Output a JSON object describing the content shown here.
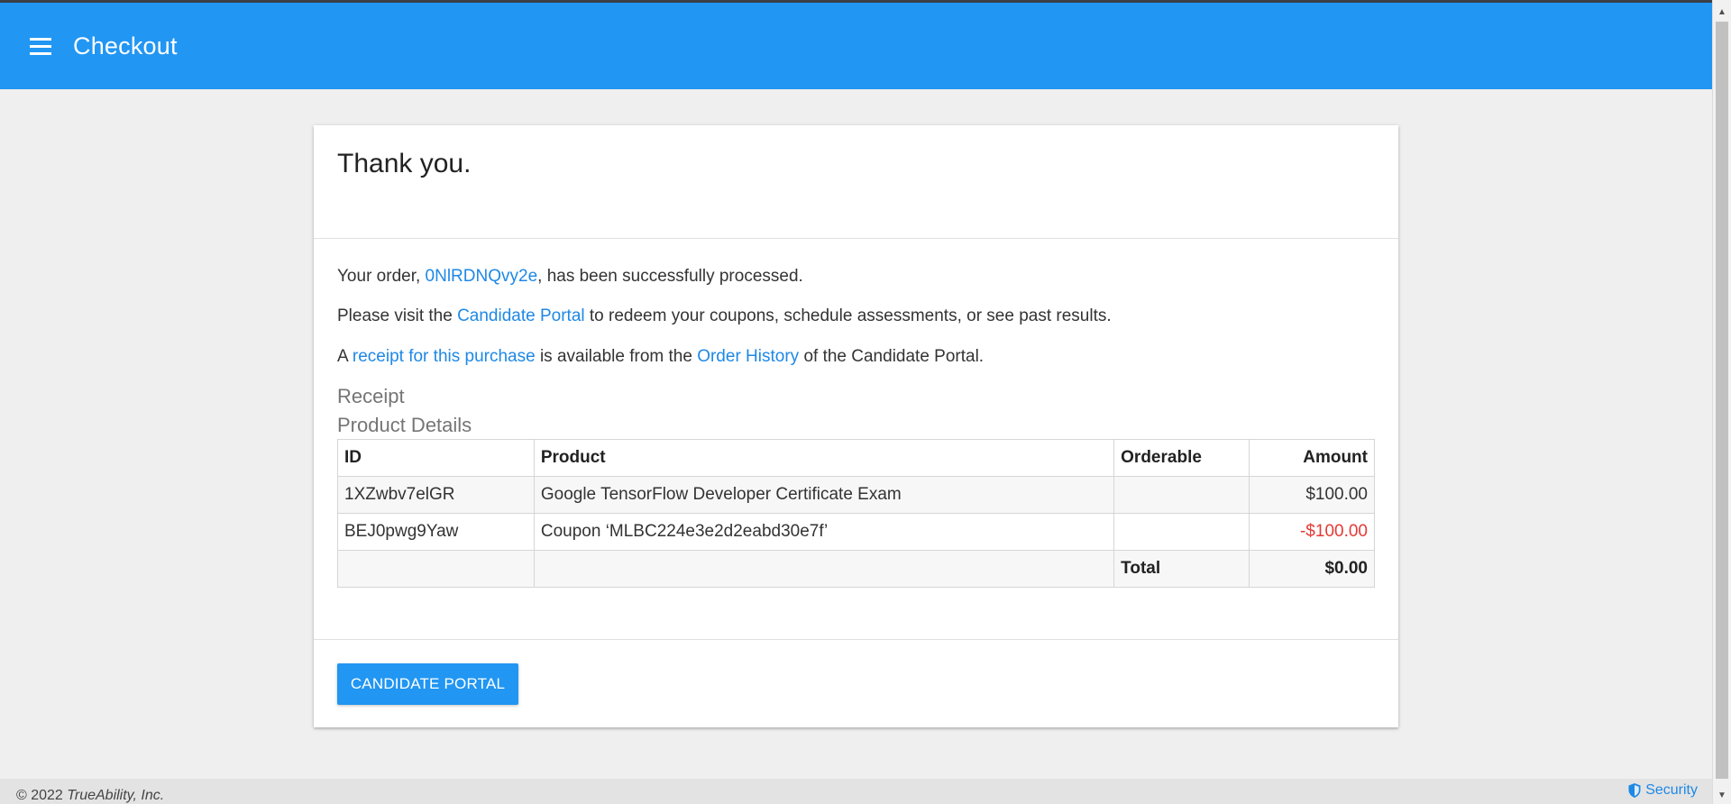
{
  "appbar": {
    "title": "Checkout",
    "menu_icon": "menu-icon"
  },
  "card": {
    "title": "Thank you.",
    "order_line": {
      "prefix": "Your order, ",
      "order_id": "0NlRDNQvy2e",
      "suffix": ", has been successfully processed."
    },
    "portal_line": {
      "prefix": "Please visit the ",
      "link": "Candidate Portal",
      "suffix": " to redeem your coupons, schedule assessments, or see past results."
    },
    "receipt_line": {
      "prefix": "A ",
      "link1": "receipt for this purchase",
      "middle": " is available from the ",
      "link2": "Order History",
      "suffix": " of the Candidate Portal."
    },
    "receipt_label": "Receipt",
    "product_details_label": "Product Details",
    "table": {
      "headers": [
        "ID",
        "Product",
        "Orderable",
        "Amount"
      ],
      "rows": [
        {
          "id": "1XZwbv7elGR",
          "product": "Google TensorFlow Developer Certificate Exam",
          "orderable": "",
          "amount": "$100.00"
        },
        {
          "id": "BEJ0pwg9Yaw",
          "product": "Coupon ‘MLBC224e3e2d2eabd30e7f’",
          "orderable": "",
          "amount": "-$100.00"
        }
      ],
      "total_label": "Total",
      "total_value": "$0.00"
    },
    "button_label": "CANDIDATE PORTAL"
  },
  "footer": {
    "copyright_prefix": "© 2022 ",
    "company": "TrueAbility, Inc.",
    "security_label": "Security",
    "security_icon": "shield-icon"
  },
  "colors": {
    "primary": "#2196f3",
    "link": "#1e88e5",
    "negative": "#e53935",
    "background": "#efefef"
  }
}
